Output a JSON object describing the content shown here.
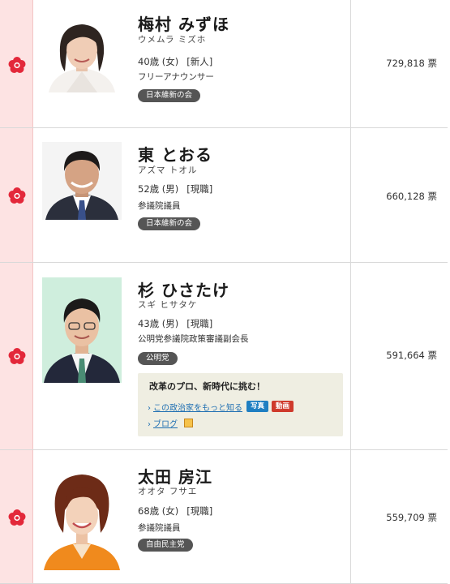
{
  "candidates": [
    {
      "name": "梅村 みずほ",
      "kana": "ウメムラ ミズホ",
      "age": "40歳 (女)",
      "status": "[新人]",
      "job": "フリーアナウンサー",
      "party": "日本維新の会",
      "votes": "729,818 票"
    },
    {
      "name": "東 とおる",
      "kana": "アズマ トオル",
      "age": "52歳 (男)",
      "status": "[現職]",
      "job": "参議院議員",
      "party": "日本維新の会",
      "votes": "660,128 票"
    },
    {
      "name": "杉 ひさたけ",
      "kana": "スギ ヒサタケ",
      "age": "43歳 (男)",
      "status": "[現職]",
      "job": "公明党参議院政策審議副会長",
      "party": "公明党",
      "votes": "591,664 票",
      "pr": {
        "title": "改革のプロ、新時代に挑む！",
        "link_more": "この政治家をもっと知る",
        "photo_badge": "写真",
        "video_badge": "動画",
        "blog_link": "ブログ"
      }
    },
    {
      "name": "太田 房江",
      "kana": "オオタ フサエ",
      "age": "68歳 (女)",
      "status": "[現職]",
      "job": "参議院議員",
      "party": "自由民主党",
      "votes": "559,709 票"
    }
  ],
  "colors": {
    "winner_mark": "#e3283a",
    "party_badge": "#555555",
    "photo_badge": "#1f7fc2",
    "video_badge": "#cf3a2c",
    "pr_background": "#efeee2",
    "mark_column": "#fde3e3"
  },
  "icons": {
    "winner": "rose-icon",
    "chevron": "chevron-right-icon",
    "blog": "blog-icon"
  }
}
